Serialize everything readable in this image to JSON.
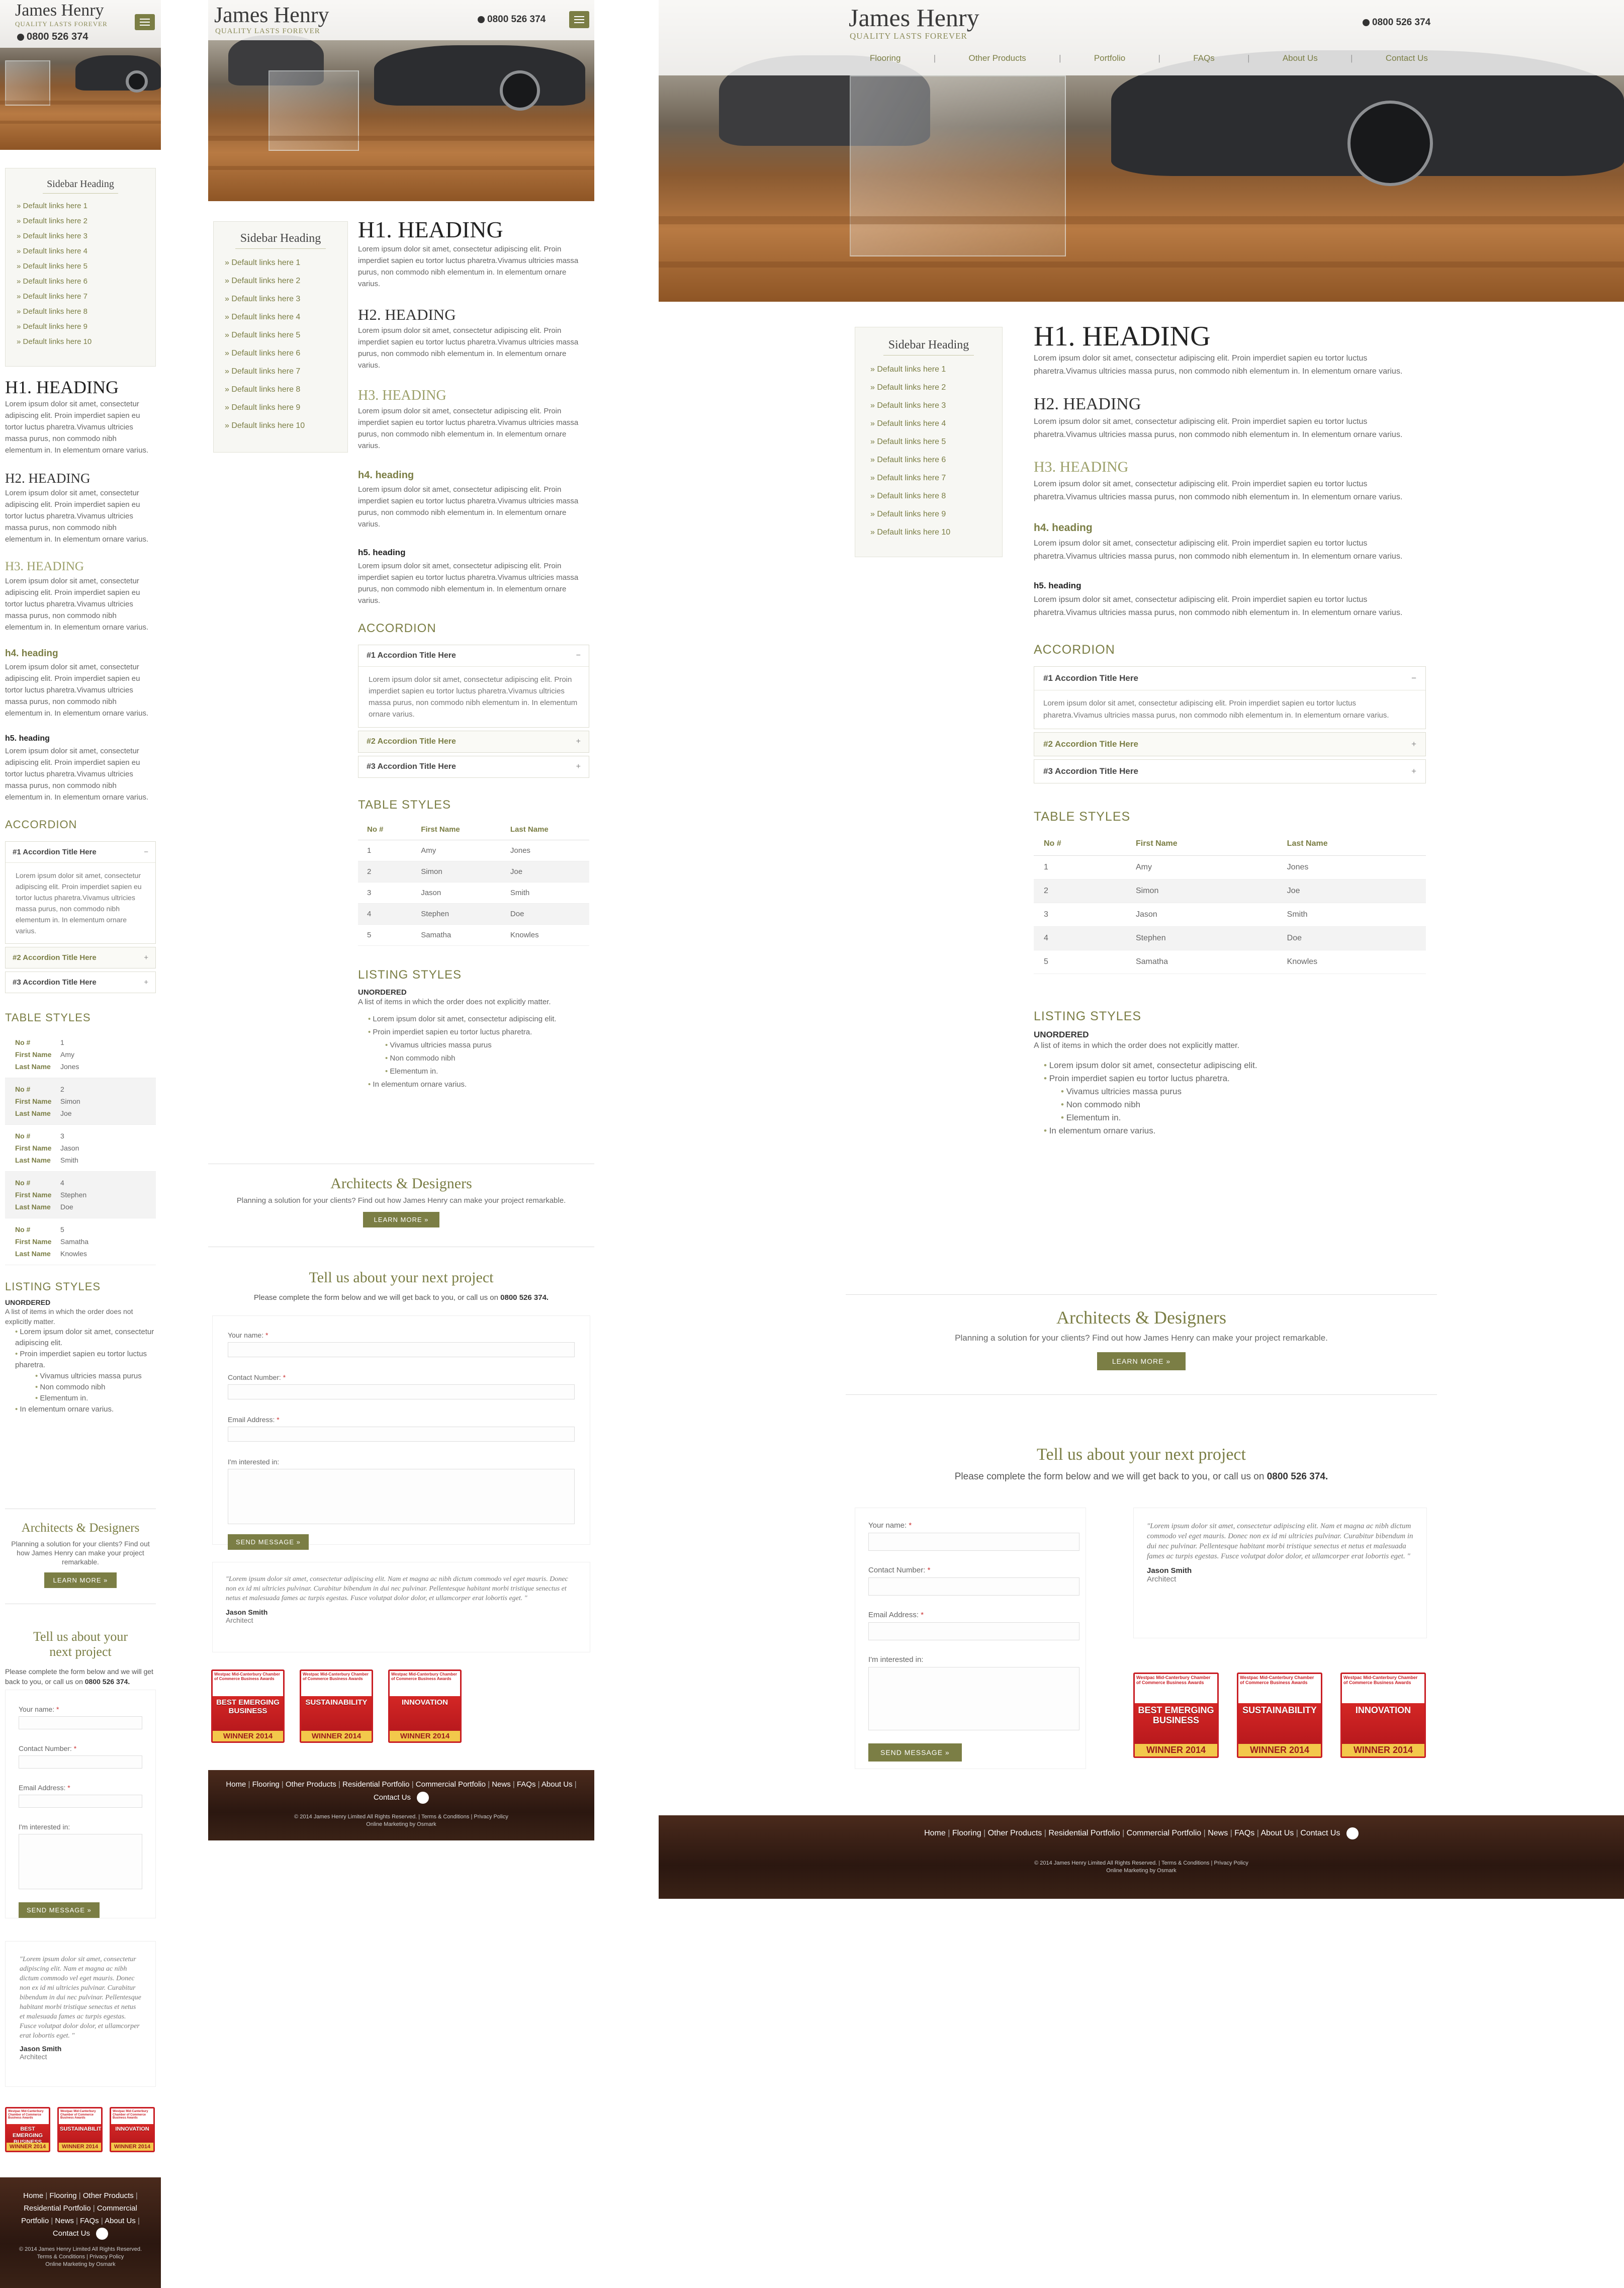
{
  "brand": {
    "name": "James Henry",
    "tagline": "QUALITY LASTS FOREVER",
    "phone": "0800 526 374"
  },
  "nav": [
    "Flooring",
    "Other Products",
    "Portfolio",
    "FAQs",
    "About Us",
    "Contact Us"
  ],
  "sidebar": {
    "heading": "Sidebar Heading",
    "links": [
      "Default links here 1",
      "Default links here 2",
      "Default links here 3",
      "Default links here 4",
      "Default links here 5",
      "Default links here 6",
      "Default links here 7",
      "Default links here 8",
      "Default links here 9",
      "Default links here 10"
    ]
  },
  "headings": {
    "h1": "H1. HEADING",
    "h2": "H2. HEADING",
    "h3": "H3. HEADING",
    "h4": "h4. heading",
    "h5": "h5. heading"
  },
  "lorem": "Lorem ipsum dolor sit amet, consectetur adipiscing elit. Proin imperdiet sapien eu tortor luctus pharetra.Vivamus ultricies massa purus, non commodo nibh elementum in. In elementum ornare varius.",
  "accordion": {
    "title": "ACCORDION",
    "items": [
      {
        "label": "#1 Accordion Title Here",
        "symbol": "−"
      },
      {
        "label": "#2 Accordion Title Here",
        "symbol": "+"
      },
      {
        "label": "#3 Accordion Title Here",
        "symbol": "+"
      }
    ],
    "body": "Lorem ipsum dolor sit amet, consectetur adipiscing elit. Proin imperdiet sapien eu tortor luctus pharetra.Vivamus ultricies massa purus, non commodo nibh elementum in. In elementum ornare varius."
  },
  "table": {
    "title": "TABLE STYLES",
    "headers": [
      "No #",
      "First Name",
      "Last Name"
    ],
    "rows": [
      [
        "1",
        "Amy",
        "Jones"
      ],
      [
        "2",
        "Simon",
        "Joe"
      ],
      [
        "3",
        "Jason",
        "Smith"
      ],
      [
        "4",
        "Stephen",
        "Doe"
      ],
      [
        "5",
        "Samatha",
        "Knowles"
      ]
    ]
  },
  "listing": {
    "title": "LISTING STYLES",
    "label": "UNORDERED",
    "intro": "A list of items in which the order does not explicitly matter.",
    "items": [
      "Lorem ipsum dolor sit amet, consectetur adipiscing elit.",
      "Proin imperdiet sapien eu tortor luctus pharetra."
    ],
    "nested": [
      "Vivamus ultricies massa purus",
      "Non commodo nibh",
      "Elementum in."
    ],
    "last": "In elementum ornare varius."
  },
  "architects": {
    "title": "Architects & Designers",
    "text": "Planning a solution for your clients?  Find out how James Henry can make your project remarkable.",
    "button": "LEARN MORE »"
  },
  "contact": {
    "title": "Tell us about your next project",
    "subtitle": "Please complete the form below and we will get back to you, or call us on",
    "phone": "0800 526 374.",
    "fields": {
      "name": "Your name:",
      "number": "Contact Number:",
      "email": "Email Address:",
      "interest": "I'm interested in:"
    },
    "required": "*",
    "button": "SEND MESSAGE »"
  },
  "testimonial": {
    "quote": "\"Lorem ipsum dolor sit amet, consectetur adipiscing elit. Nam et magna ac nibh dictum commodo vel eget mauris. Donec non ex id mi ultricies pulvinar. Curabitur bibendum in dui nec pulvinar. Pellentesque habitant morbi tristique senectus et netus et malesuada fames ac turpis egestas. Fusce volutpat dolor dolor, et ullamcorper erat lobortis eget. \"",
    "name": "Jason Smith",
    "role": "Architect"
  },
  "awards": [
    {
      "title": "BEST EMERGING BUSINESS",
      "winner": "WINNER 2014"
    },
    {
      "title": "SUSTAINABILITY",
      "winner": "WINNER 2014"
    },
    {
      "title": "INNOVATION",
      "winner": "WINNER 2014"
    }
  ],
  "awards_org": "Westpac Mid-Canterbury Chamber of Commerce Business Awards",
  "footer": {
    "links": [
      "Home",
      "Flooring",
      "Other Products",
      "Residential Portfolio",
      "Commercial Portfolio",
      "News",
      "FAQs",
      "About Us",
      "Contact Us"
    ],
    "copyright": "© 2014 James Henry Limited All Rights Reserved.",
    "terms": "Terms & Conditions",
    "privacy": "Privacy Policy",
    "credit": "Online Marketing by Osmark",
    "fb": "f"
  },
  "colors": {
    "accent": "#7b7e45",
    "accent_light": "#9ca06a",
    "badge_red": "#c91e24",
    "footer_wood": "#2b1710"
  }
}
